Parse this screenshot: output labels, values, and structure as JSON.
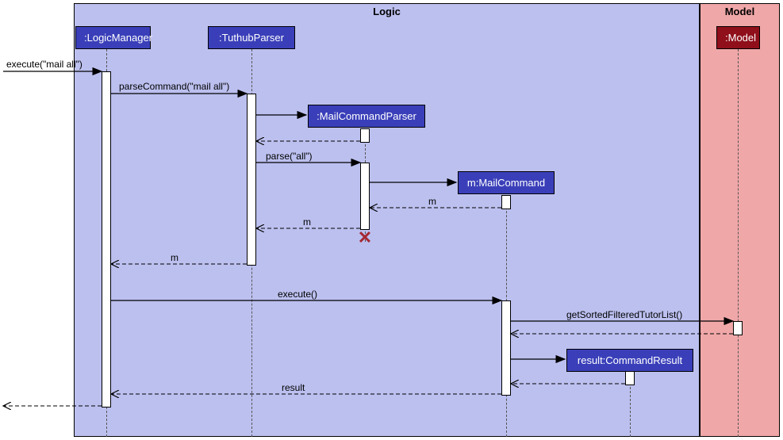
{
  "chart_data": {
    "type": "sequence-diagram",
    "frames": [
      {
        "name": "Logic",
        "color": "#bcc0ef"
      },
      {
        "name": "Model",
        "color": "#f0a7a8"
      }
    ],
    "participants": [
      {
        "id": "Actor",
        "label": "",
        "frame": null
      },
      {
        "id": "LogicManager",
        "label": ":LogicManager",
        "frame": "Logic"
      },
      {
        "id": "TuthubParser",
        "label": ":TuthubParser",
        "frame": "Logic"
      },
      {
        "id": "MailCommandParser",
        "label": ":MailCommandParser",
        "frame": "Logic",
        "created": true
      },
      {
        "id": "MailCommand",
        "label": "m:MailCommand",
        "frame": "Logic",
        "created": true
      },
      {
        "id": "CommandResult",
        "label": "result:CommandResult",
        "frame": "Logic",
        "created": true
      },
      {
        "id": "Model",
        "label": ":Model",
        "frame": "Model"
      }
    ],
    "messages": [
      {
        "from": "Actor",
        "to": "LogicManager",
        "label": "execute(\"mail all\")",
        "type": "call"
      },
      {
        "from": "LogicManager",
        "to": "TuthubParser",
        "label": "parseCommand(\"mail all\")",
        "type": "call"
      },
      {
        "from": "TuthubParser",
        "to": "MailCommandParser",
        "label": "",
        "type": "create"
      },
      {
        "from": "MailCommandParser",
        "to": "TuthubParser",
        "label": "",
        "type": "return"
      },
      {
        "from": "TuthubParser",
        "to": "MailCommandParser",
        "label": "parse(\"all\")",
        "type": "call"
      },
      {
        "from": "MailCommandParser",
        "to": "MailCommand",
        "label": "",
        "type": "create"
      },
      {
        "from": "MailCommand",
        "to": "MailCommandParser",
        "label": "m",
        "type": "return"
      },
      {
        "from": "MailCommandParser",
        "to": "TuthubParser",
        "label": "m",
        "type": "return"
      },
      {
        "from": "MailCommandParser",
        "to": null,
        "label": "",
        "type": "destroy"
      },
      {
        "from": "TuthubParser",
        "to": "LogicManager",
        "label": "m",
        "type": "return"
      },
      {
        "from": "LogicManager",
        "to": "MailCommand",
        "label": "execute()",
        "type": "call"
      },
      {
        "from": "MailCommand",
        "to": "Model",
        "label": "getSortedFilteredTutorList()",
        "type": "call"
      },
      {
        "from": "Model",
        "to": "MailCommand",
        "label": "",
        "type": "return"
      },
      {
        "from": "MailCommand",
        "to": "CommandResult",
        "label": "",
        "type": "create"
      },
      {
        "from": "CommandResult",
        "to": "MailCommand",
        "label": "",
        "type": "return"
      },
      {
        "from": "MailCommand",
        "to": "LogicManager",
        "label": "result",
        "type": "return"
      },
      {
        "from": "LogicManager",
        "to": "Actor",
        "label": "",
        "type": "return"
      }
    ]
  },
  "frames": {
    "logic": {
      "title": "Logic"
    },
    "model": {
      "title": "Model"
    }
  },
  "heads": {
    "logicManager": ":LogicManager",
    "tuthubParser": ":TuthubParser",
    "mailCommandParser": ":MailCommandParser",
    "mailCommand": "m:MailCommand",
    "commandResult": "result:CommandResult",
    "model": ":Model"
  },
  "labels": {
    "execute_mail_all": "execute(\"mail all\")",
    "parseCommand": "parseCommand(\"mail all\")",
    "parse_all": "parse(\"all\")",
    "m1": "m",
    "m2": "m",
    "m3": "m",
    "execute": "execute()",
    "getSorted": "getSortedFilteredTutorList()",
    "result": "result"
  }
}
